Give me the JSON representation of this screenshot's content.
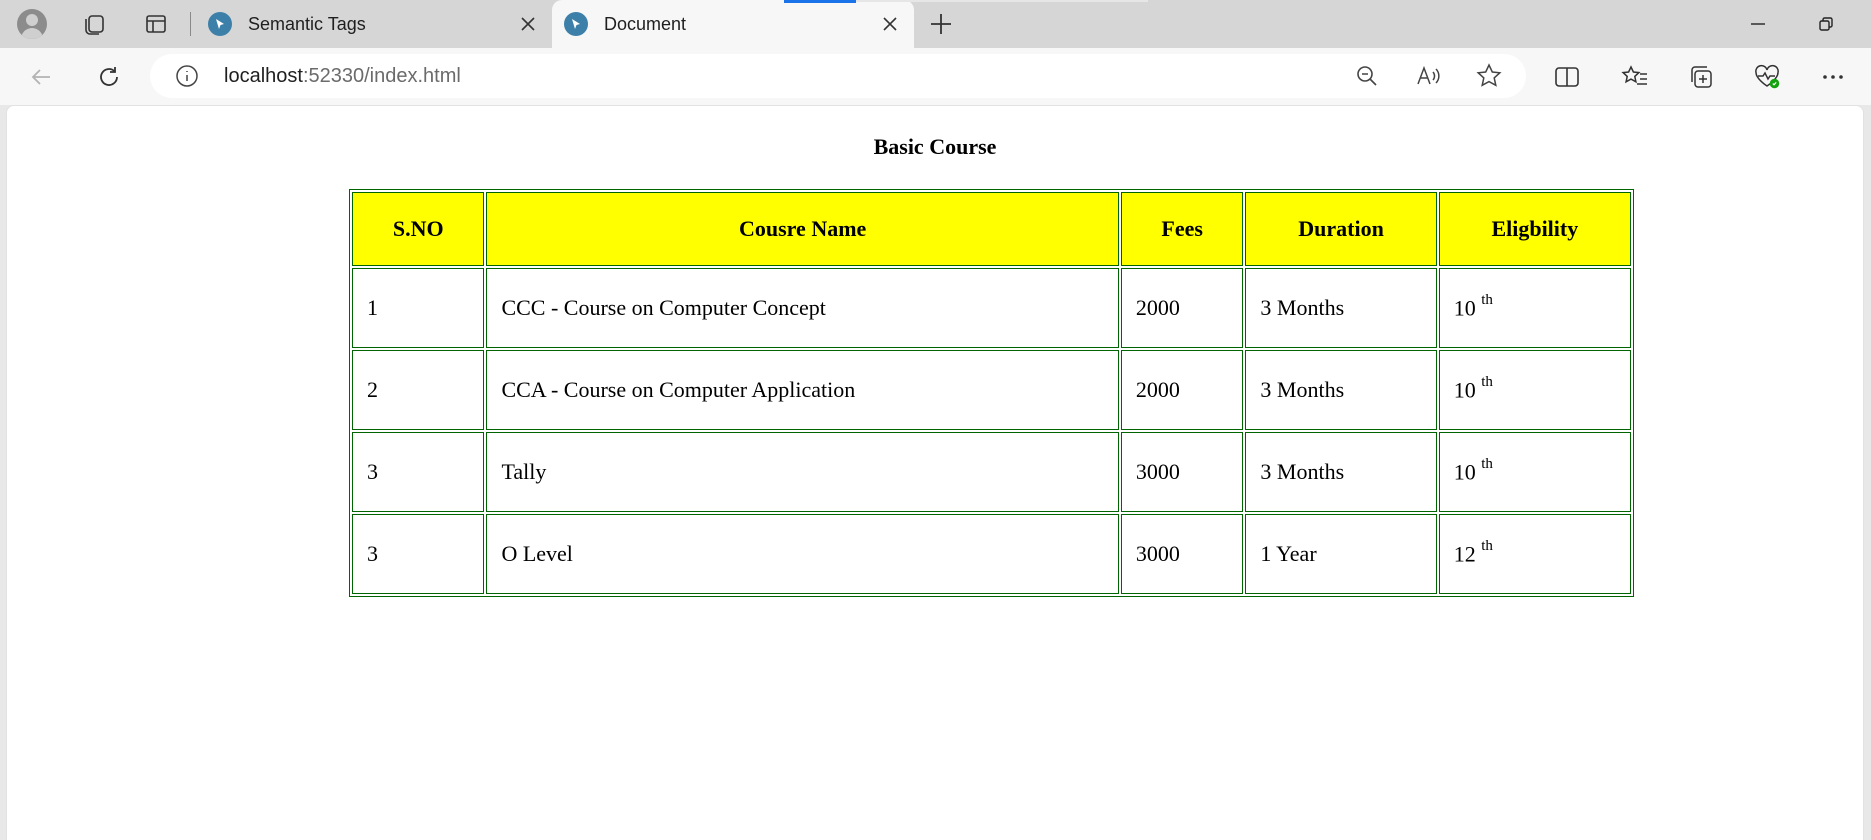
{
  "browser": {
    "tabs": [
      {
        "title": "Semantic Tags"
      },
      {
        "title": "Document"
      }
    ],
    "address": {
      "host": "localhost",
      "rest": ":52330/index.html"
    }
  },
  "page": {
    "caption": "Basic Course",
    "headers": [
      "S.NO",
      "Cousre Name",
      "Fees",
      "Duration",
      "Eligbility"
    ],
    "rows": [
      {
        "sno": "1",
        "name": "CCC - Course on Computer Concept",
        "fees": "2000",
        "duration": "3 Months",
        "elig": "10",
        "sup": "th"
      },
      {
        "sno": "2",
        "name": "CCA - Course on Computer Application",
        "fees": "2000",
        "duration": "3 Months",
        "elig": "10",
        "sup": "th"
      },
      {
        "sno": "3",
        "name": "Tally",
        "fees": "3000",
        "duration": "3 Months",
        "elig": "10",
        "sup": "th"
      },
      {
        "sno": "3",
        "name": "O Level",
        "fees": "3000",
        "duration": "1 Year",
        "elig": "12",
        "sup": "th"
      }
    ],
    "colors": {
      "header_bg": "#ffff00",
      "border": "#006400"
    }
  }
}
